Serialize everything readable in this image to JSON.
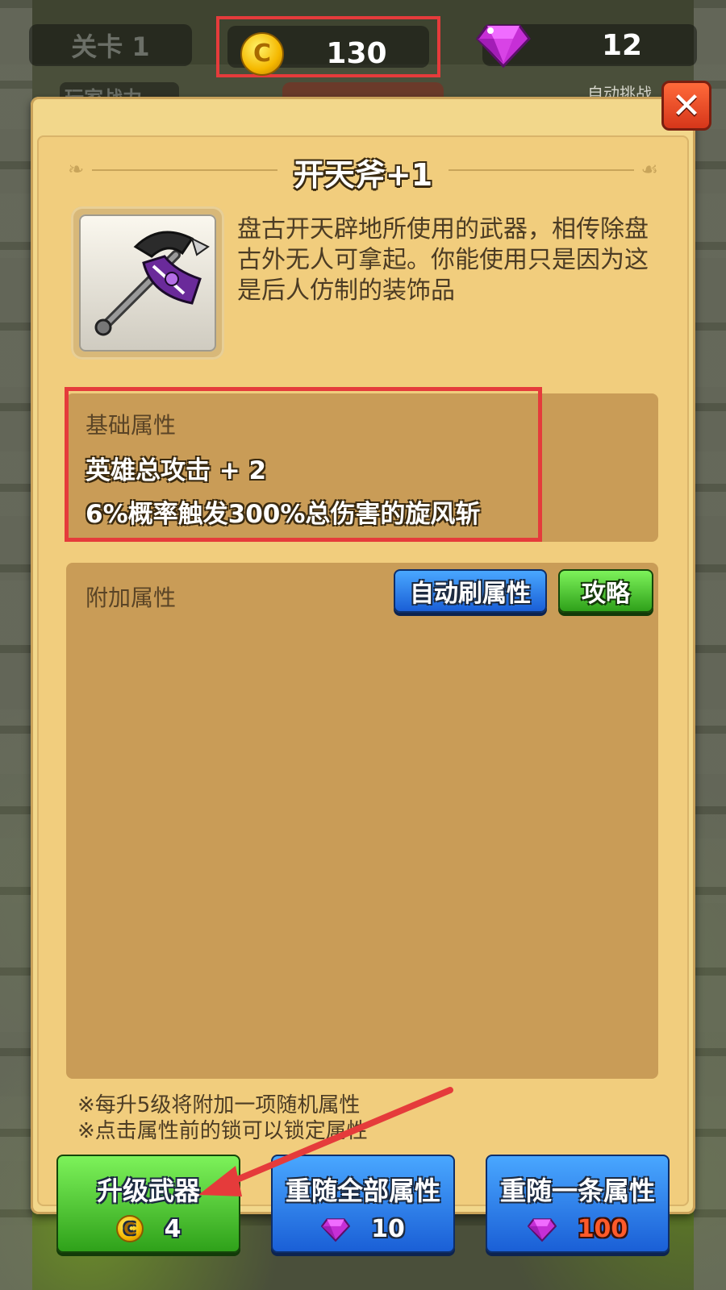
{
  "hud": {
    "level_label": "关卡 1",
    "coins": "130",
    "gems": "12",
    "behind_left": "玩家战力",
    "behind_right": "自动挑战"
  },
  "item": {
    "title": "开天斧+1",
    "description": "盘古开天辟地所使用的武器，相传除盘古外无人可拿起。你能使用只是因为这是后人仿制的装饰品"
  },
  "base_attributes": {
    "label": "基础属性",
    "lines": [
      "英雄总攻击 + 2",
      "6%概率触发300%总伤害的旋风斩"
    ]
  },
  "extra_attributes": {
    "label": "附加属性",
    "auto_refresh_label": "自动刷属性",
    "guide_label": "攻略"
  },
  "notes": [
    "※每升5级将附加一项随机属性",
    "※点击属性前的锁可以锁定属性"
  ],
  "actions": {
    "upgrade": {
      "label": "升级武器",
      "cost": "4",
      "currency": "coin"
    },
    "reroll_all": {
      "label": "重随全部属性",
      "cost": "10",
      "currency": "gem"
    },
    "reroll_one": {
      "label": "重随一条属性",
      "cost": "100",
      "currency": "gem"
    }
  },
  "colors": {
    "highlight": "#e53b3b",
    "panel": "#f2d78b",
    "attribute_box": "#c99c57"
  },
  "icons": [
    "coin-icon",
    "gem-icon",
    "close-icon",
    "axe-icon"
  ]
}
